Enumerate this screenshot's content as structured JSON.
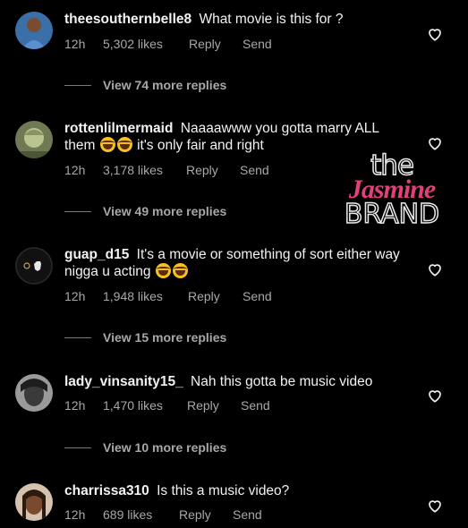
{
  "colors": {
    "background": "#000000",
    "text_primary": "#f2f2f2",
    "text_secondary": "#a8a8a8",
    "watermark_accent": "#e0407b"
  },
  "comments": [
    {
      "username": "theesouthernbelle8",
      "text": "What movie is this for ?",
      "time": "12h",
      "likes": "5,302 likes",
      "reply_label": "Reply",
      "send_label": "Send",
      "view_replies": "View 74 more replies",
      "icon": "heart-outline-icon"
    },
    {
      "username": "rottenlilmermaid",
      "text_before": "Naaaawww you gotta marry ALL them",
      "text_after": "it's only fair and right",
      "emojis": [
        "face-with-tears-of-joy-emoji",
        "face-with-tears-of-joy-emoji"
      ],
      "time": "12h",
      "likes": "3,178 likes",
      "reply_label": "Reply",
      "send_label": "Send",
      "view_replies": "View 49 more replies",
      "icon": "heart-outline-icon"
    },
    {
      "username": "guap_d15",
      "text_before": "It's a movie or something of sort either way nigga u acting",
      "emojis": [
        "face-with-tears-of-joy-emoji",
        "face-with-tears-of-joy-emoji"
      ],
      "time": "12h",
      "likes": "1,948 likes",
      "reply_label": "Reply",
      "send_label": "Send",
      "view_replies": "View 15 more replies",
      "icon": "heart-outline-icon"
    },
    {
      "username": "lady_vinsanity15_",
      "text": "Nah this gotta be music video",
      "time": "12h",
      "likes": "1,470 likes",
      "reply_label": "Reply",
      "send_label": "Send",
      "view_replies": "View 10 more replies",
      "icon": "heart-outline-icon"
    },
    {
      "username": "charrissa310",
      "text": "Is this a music video?",
      "time": "12h",
      "likes": "689 likes",
      "reply_label": "Reply",
      "send_label": "Send",
      "icon": "heart-outline-icon"
    }
  ],
  "watermark": {
    "line1": "the",
    "line2": "Jasmine",
    "line3": "BRAND"
  }
}
